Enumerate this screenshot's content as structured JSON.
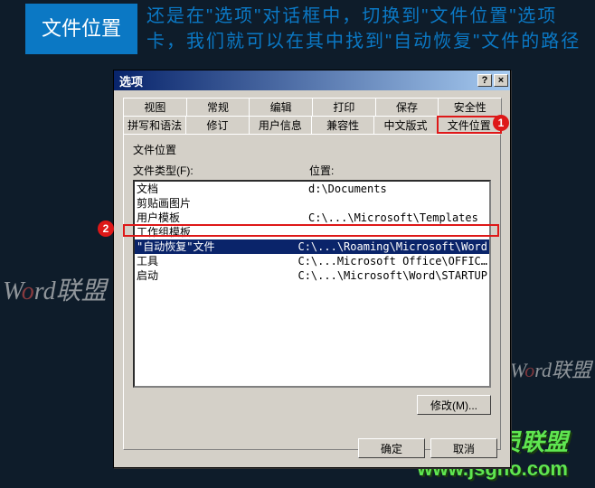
{
  "header": {
    "badge": "文件位置",
    "text": "还是在\"选项\"对话框中，切换到\"文件位置\"选项卡，我们就可以在其中找到\"自动恢复\"文件的路径"
  },
  "watermark": {
    "left_prefix": "W",
    "left_red": "o",
    "left_suffix": "rd联盟",
    "right_prefix": "W",
    "right_red": "o",
    "right_suffix": "rd联盟",
    "bottom1": "技术员联盟",
    "bottom2": "www.jsgho.com"
  },
  "dialog": {
    "title": "选项",
    "help_glyph": "?",
    "close_glyph": "×",
    "tabs_row1": [
      "视图",
      "常规",
      "编辑",
      "打印",
      "保存",
      "安全性"
    ],
    "tabs_row2": [
      "拼写和语法",
      "修订",
      "用户信息",
      "兼容性",
      "中文版式",
      "文件位置"
    ],
    "section": "文件位置",
    "col1": "文件类型(F):",
    "col2": "位置:",
    "rows": [
      {
        "type": "文档",
        "location": "d:\\Documents"
      },
      {
        "type": "剪贴画图片",
        "location": ""
      },
      {
        "type": "用户模板",
        "location": "C:\\...\\Microsoft\\Templates"
      },
      {
        "type": "工作组模板",
        "location": ""
      },
      {
        "type": "\"自动恢复\"文件",
        "location": "C:\\...\\Roaming\\Microsoft\\Word"
      },
      {
        "type": "工具",
        "location": "C:\\...Microsoft Office\\OFFIC…"
      },
      {
        "type": "启动",
        "location": "C:\\...\\Microsoft\\Word\\STARTUP"
      }
    ],
    "selected_index": 4,
    "modify_button": "修改(M)...",
    "ok_button": "确定",
    "cancel_button": "取消"
  },
  "callouts": {
    "c1": "1",
    "c2": "2"
  }
}
